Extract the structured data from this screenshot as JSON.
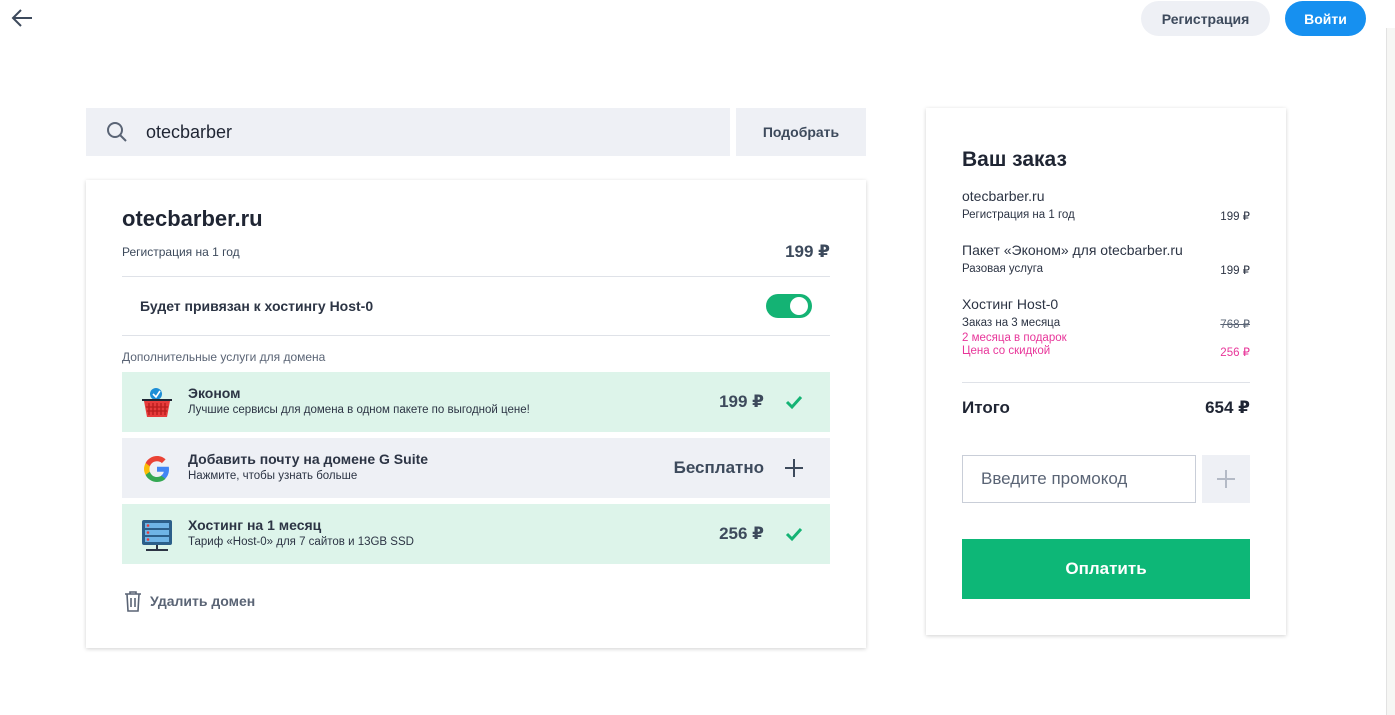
{
  "header": {
    "register_label": "Регистрация",
    "login_label": "Войти"
  },
  "search": {
    "value": "otecbarber",
    "placeholder": "",
    "pick_label": "Подобрать"
  },
  "domain_card": {
    "domain": "otecbarber.ru",
    "registration_label": "Регистрация на 1 год",
    "registration_price": "199 ₽",
    "hosting_bind_label": "Будет привязан к хостингу Host-0",
    "hosting_bind_enabled": true,
    "extras_title": "Дополнительные услуги для домена",
    "services": [
      {
        "name": "Эконом",
        "desc": "Лучшие сервисы для домена в одном пакете по выгодной цене!",
        "price": "199 ₽",
        "selected": true
      },
      {
        "name": "Добавить почту на домене G Suite",
        "desc": "Нажмите, чтобы узнать больше",
        "price": "Бесплатно",
        "selected": false
      },
      {
        "name": "Хостинг на 1 месяц",
        "desc": "Тариф «Host-0» для 7 сайтов и 13GB SSD",
        "price": "256 ₽",
        "selected": true
      }
    ],
    "delete_label": "Удалить домен"
  },
  "order": {
    "title": "Ваш заказ",
    "items": [
      {
        "title": "otecbarber.ru",
        "sub": "Регистрация на 1 год",
        "price": "199 ₽"
      },
      {
        "title": "Пакет «Эконом» для otecbarber.ru",
        "sub": "Разовая услуга",
        "price": "199 ₽"
      },
      {
        "title": "Хостинг Host-0",
        "sub": "Заказ на 3 месяца",
        "price": "768 ₽",
        "gift": "2 месяца в подарок",
        "discount_label": "Цена со скидкой",
        "discount_price": "256 ₽"
      }
    ],
    "total_label": "Итого",
    "total_value": "654 ₽",
    "promo_placeholder": "Введите промокод",
    "pay_label": "Оплатить"
  },
  "colors": {
    "accent": "#1690f0",
    "green": "#0db777",
    "pink": "#e8369a"
  }
}
